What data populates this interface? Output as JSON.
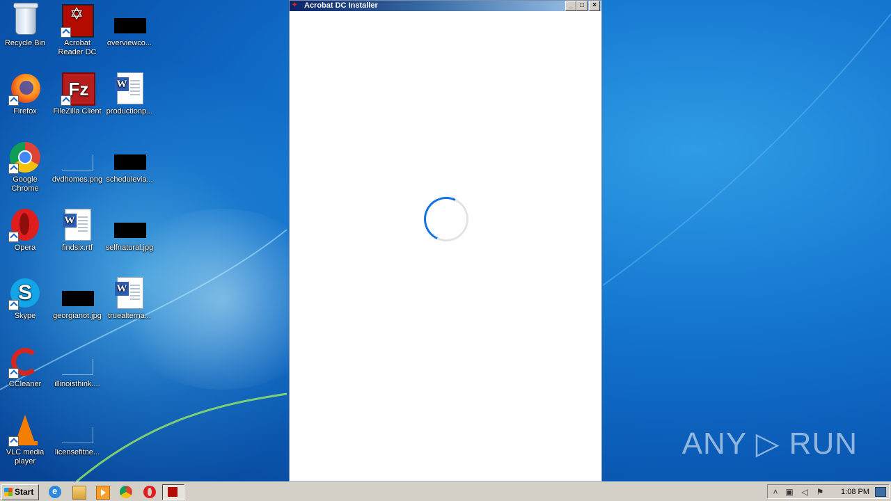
{
  "desktop": {
    "icons": [
      {
        "label": "Recycle Bin",
        "icon": "recycle-bin-icon"
      },
      {
        "label": "Acrobat Reader DC",
        "icon": "acrobat-reader-icon"
      },
      {
        "label": "overviewco...",
        "icon": "image-file-icon"
      },
      {
        "label": "Firefox",
        "icon": "firefox-icon"
      },
      {
        "label": "FileZilla Client",
        "icon": "filezilla-icon"
      },
      {
        "label": "productionp...",
        "icon": "word-document-icon"
      },
      {
        "label": "Google Chrome",
        "icon": "chrome-icon"
      },
      {
        "label": "dvdhomes.png",
        "icon": "image-file-icon"
      },
      {
        "label": "schedulevia...",
        "icon": "image-file-icon"
      },
      {
        "label": "Opera",
        "icon": "opera-icon"
      },
      {
        "label": "findsix.rtf",
        "icon": "word-document-icon"
      },
      {
        "label": "selfnatural.jpg",
        "icon": "image-file-icon"
      },
      {
        "label": "Skype",
        "icon": "skype-icon"
      },
      {
        "label": "georgianot.jpg",
        "icon": "image-file-icon"
      },
      {
        "label": "truealterna...",
        "icon": "word-document-icon"
      },
      {
        "label": "CCleaner",
        "icon": "ccleaner-icon"
      },
      {
        "label": "illinoisthink....",
        "icon": "image-file-icon"
      },
      {
        "label": "VLC media player",
        "icon": "vlc-icon"
      },
      {
        "label": "licensefitne...",
        "icon": "image-file-icon"
      }
    ]
  },
  "window": {
    "title": "Acrobat DC Installer",
    "title_icon": "acrobat-icon",
    "buttons": {
      "minimize": "_",
      "maximize": "□",
      "close": "×"
    },
    "loading": true,
    "spinner_color": "#1473e6"
  },
  "watermark": {
    "text": "ANY ▷ RUN"
  },
  "taskbar": {
    "start_label": "Start",
    "quick_launch": [
      "internet-explorer-icon",
      "windows-explorer-icon",
      "media-player-icon",
      "chrome-icon",
      "opera-icon"
    ],
    "active_task": "acrobat-installer-task",
    "tray": {
      "icons": [
        "show-hidden-icons-chevron",
        "network-icon",
        "volume-icon",
        "action-center-flag-icon"
      ],
      "clock": "1:08 PM"
    }
  },
  "colors": {
    "desktop_blue": "#0b5db8",
    "taskbar_gray": "#d4d0c8",
    "acrobat_red": "#b30b00"
  }
}
